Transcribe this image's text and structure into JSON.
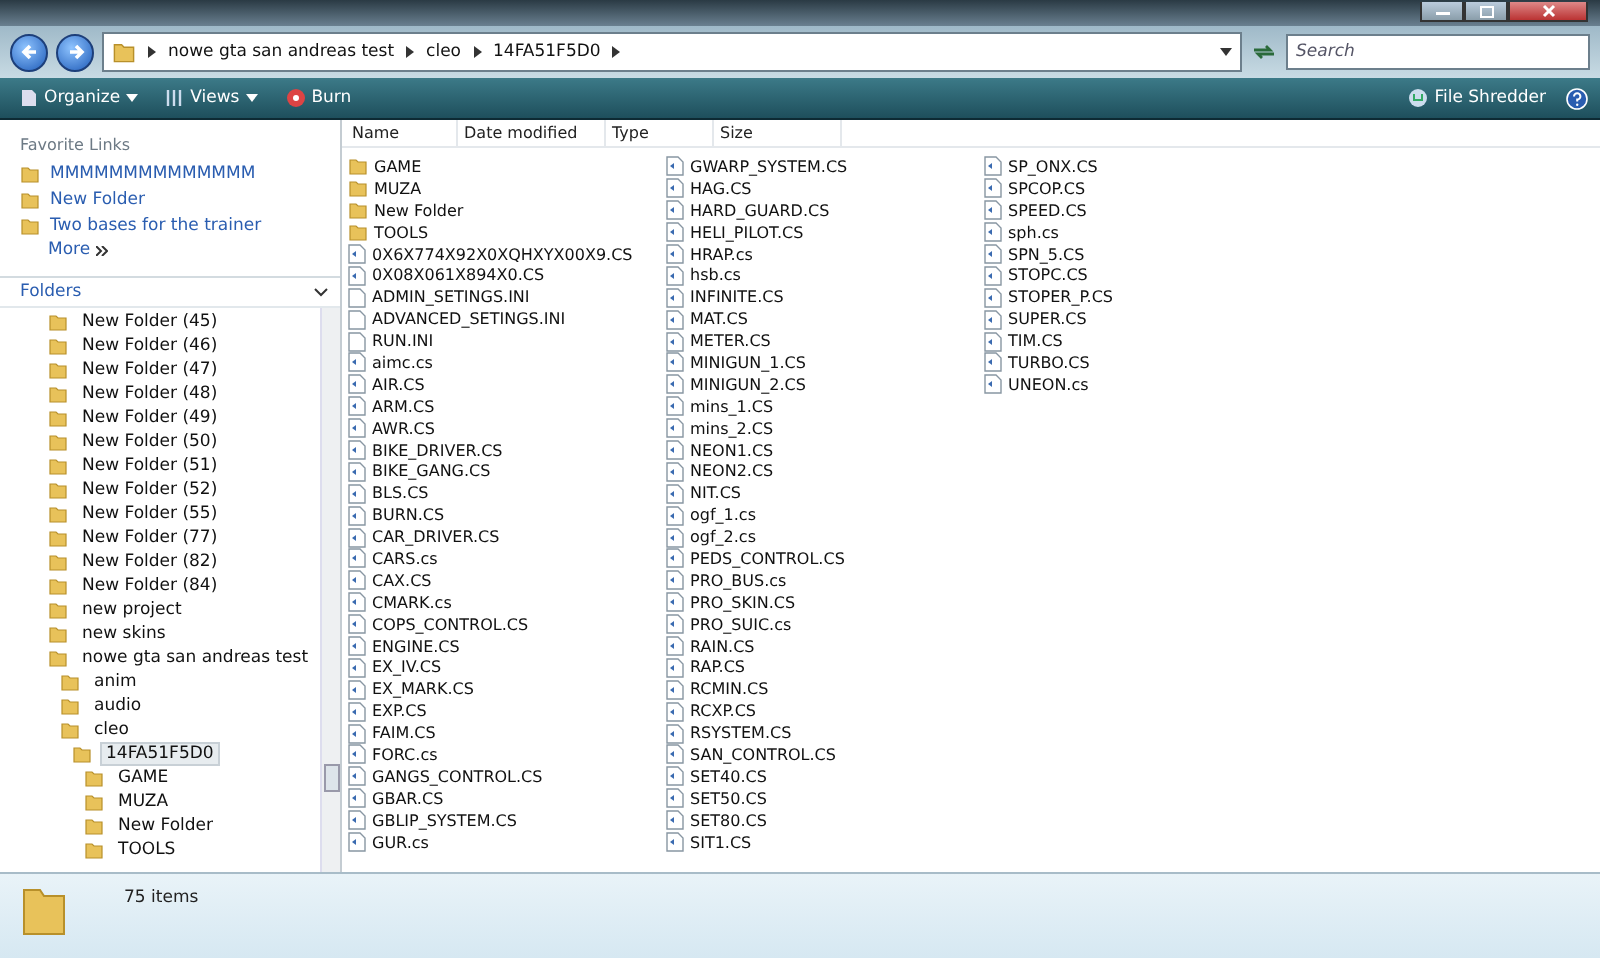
{
  "address": {
    "crumbs": [
      "nowe gta san andreas test",
      "cleo",
      "14FA51F5D0"
    ]
  },
  "search": {
    "placeholder": "Search"
  },
  "toolbar": {
    "buttons": [
      {
        "label": "Organize",
        "kind": "menu"
      },
      {
        "label": "Views",
        "kind": "split"
      },
      {
        "label": "Burn",
        "kind": "plain"
      }
    ],
    "right": "File Shredder"
  },
  "favorites": {
    "title": "Favorite Links",
    "links": [
      "MMMMMMMMMMMMMM",
      "New Folder",
      "Two bases for the trainer"
    ],
    "more": "More"
  },
  "folders": {
    "title": "Folders",
    "tree": [
      {
        "label": "New Folder (45)",
        "selected": false
      },
      {
        "label": "New Folder (46)",
        "selected": false
      },
      {
        "label": "New Folder (47)",
        "selected": false
      },
      {
        "label": "New Folder (48)",
        "selected": false
      },
      {
        "label": "New Folder (49)",
        "selected": false
      },
      {
        "label": "New Folder (50)",
        "selected": false
      },
      {
        "label": "New Folder (51)",
        "selected": false
      },
      {
        "label": "New Folder (52)",
        "selected": false
      },
      {
        "label": "New Folder (55)",
        "selected": false
      },
      {
        "label": "New Folder (77)",
        "selected": false
      },
      {
        "label": "New Folder (82)",
        "selected": false
      },
      {
        "label": "New Folder (84)",
        "selected": false
      },
      {
        "label": "new project",
        "selected": false
      },
      {
        "label": "new skins",
        "selected": false
      },
      {
        "label": "nowe gta san andreas test",
        "selected": false,
        "children": [
          {
            "label": "anim",
            "selected": false
          },
          {
            "label": "audio",
            "selected": false
          },
          {
            "label": "cleo",
            "selected": false,
            "children": [
              {
                "label": "14FA51F5D0",
                "selected": true,
                "children": [
                  {
                    "label": "GAME",
                    "selected": false
                  },
                  {
                    "label": "MUZA",
                    "selected": false
                  },
                  {
                    "label": "New Folder",
                    "selected": false
                  },
                  {
                    "label": "TOOLS",
                    "selected": false
                  }
                ]
              }
            ]
          }
        ]
      }
    ]
  },
  "table": {
    "columns": [
      "Name",
      "Date modified",
      "Type",
      "Size"
    ],
    "files": [
      {
        "name": "GAME",
        "kind": "folder"
      },
      {
        "name": "MUZA",
        "kind": "folder"
      },
      {
        "name": "New Folder",
        "kind": "folder"
      },
      {
        "name": "TOOLS",
        "kind": "folder"
      },
      {
        "name": "0X6X774X92X0XQHXYX00X9.CS",
        "kind": "script"
      },
      {
        "name": "0X08X061X894X0.CS",
        "kind": "script"
      },
      {
        "name": "ADMIN_SETINGS.INI",
        "kind": "ini"
      },
      {
        "name": "ADVANCED_SETINGS.INI",
        "kind": "ini"
      },
      {
        "name": "RUN.INI",
        "kind": "ini"
      },
      {
        "name": "aimc.cs",
        "kind": "script"
      },
      {
        "name": "AIR.CS",
        "kind": "script"
      },
      {
        "name": "ARM.CS",
        "kind": "script"
      },
      {
        "name": "AWR.CS",
        "kind": "script"
      },
      {
        "name": "BIKE_DRIVER.CS",
        "kind": "script"
      },
      {
        "name": "BIKE_GANG.CS",
        "kind": "script"
      },
      {
        "name": "BLS.CS",
        "kind": "script"
      },
      {
        "name": "BURN.CS",
        "kind": "script"
      },
      {
        "name": "CAR_DRIVER.CS",
        "kind": "script"
      },
      {
        "name": "CARS.cs",
        "kind": "script"
      },
      {
        "name": "CAX.CS",
        "kind": "script"
      },
      {
        "name": "CMARK.cs",
        "kind": "script"
      },
      {
        "name": "COPS_CONTROL.CS",
        "kind": "script"
      },
      {
        "name": "ENGINE.CS",
        "kind": "script"
      },
      {
        "name": "EX_IV.CS",
        "kind": "script"
      },
      {
        "name": "EX_MARK.CS",
        "kind": "script"
      },
      {
        "name": "EXP.CS",
        "kind": "script"
      },
      {
        "name": "FAIM.CS",
        "kind": "script"
      },
      {
        "name": "FORC.cs",
        "kind": "script"
      },
      {
        "name": "GANGS_CONTROL.CS",
        "kind": "script"
      },
      {
        "name": "GBAR.CS",
        "kind": "script"
      },
      {
        "name": "GBLIP_SYSTEM.CS",
        "kind": "script"
      },
      {
        "name": "GUR.cs",
        "kind": "script"
      },
      {
        "name": "GWARP_SYSTEM.CS",
        "kind": "script"
      },
      {
        "name": "HAG.CS",
        "kind": "script"
      },
      {
        "name": "HARD_GUARD.CS",
        "kind": "script"
      },
      {
        "name": "HELI_PILOT.CS",
        "kind": "script"
      },
      {
        "name": "HRAP.cs",
        "kind": "script"
      },
      {
        "name": "hsb.cs",
        "kind": "script"
      },
      {
        "name": "INFINITE.CS",
        "kind": "script"
      },
      {
        "name": "MAT.CS",
        "kind": "script"
      },
      {
        "name": "METER.CS",
        "kind": "script"
      },
      {
        "name": "MINIGUN_1.CS",
        "kind": "script"
      },
      {
        "name": "MINIGUN_2.CS",
        "kind": "script"
      },
      {
        "name": "mins_1.CS",
        "kind": "script"
      },
      {
        "name": "mins_2.CS",
        "kind": "script"
      },
      {
        "name": "NEON1.CS",
        "kind": "script"
      },
      {
        "name": "NEON2.CS",
        "kind": "script"
      },
      {
        "name": "NIT.CS",
        "kind": "script"
      },
      {
        "name": "ogf_1.cs",
        "kind": "script"
      },
      {
        "name": "ogf_2.cs",
        "kind": "script"
      },
      {
        "name": "PEDS_CONTROL.CS",
        "kind": "script"
      },
      {
        "name": "PRO_BUS.cs",
        "kind": "script"
      },
      {
        "name": "PRO_SKIN.CS",
        "kind": "script"
      },
      {
        "name": "PRO_SUIC.cs",
        "kind": "script"
      },
      {
        "name": "RAIN.CS",
        "kind": "script"
      },
      {
        "name": "RAP.CS",
        "kind": "script"
      },
      {
        "name": "RCMIN.CS",
        "kind": "script"
      },
      {
        "name": "RCXP.CS",
        "kind": "script"
      },
      {
        "name": "RSYSTEM.CS",
        "kind": "script"
      },
      {
        "name": "SAN_CONTROL.CS",
        "kind": "script"
      },
      {
        "name": "SET40.CS",
        "kind": "script"
      },
      {
        "name": "SET50.CS",
        "kind": "script"
      },
      {
        "name": "SET80.CS",
        "kind": "script"
      },
      {
        "name": "SIT1.CS",
        "kind": "script"
      },
      {
        "name": "SP_ONX.CS",
        "kind": "script"
      },
      {
        "name": "SPCOP.CS",
        "kind": "script"
      },
      {
        "name": "SPEED.CS",
        "kind": "script"
      },
      {
        "name": "sph.cs",
        "kind": "script"
      },
      {
        "name": "SPN_5.CS",
        "kind": "script"
      },
      {
        "name": "STOPC.CS",
        "kind": "script"
      },
      {
        "name": "STOPER_P.CS",
        "kind": "script"
      },
      {
        "name": "SUPER.CS",
        "kind": "script"
      },
      {
        "name": "TIM.CS",
        "kind": "script"
      },
      {
        "name": "TURBO.CS",
        "kind": "script"
      },
      {
        "name": "UNEON.cs",
        "kind": "script"
      }
    ]
  },
  "status_bar": {
    "count": "75 items"
  }
}
